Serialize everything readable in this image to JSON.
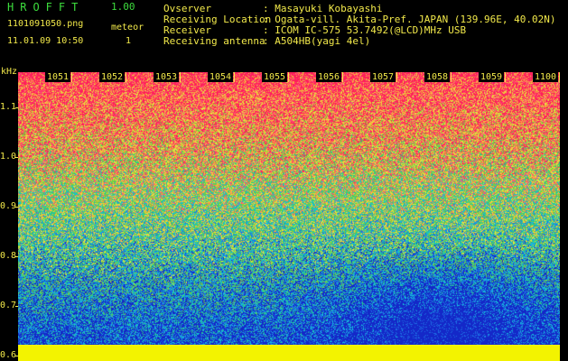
{
  "header": {
    "app_title": "HROFFT",
    "version": "1.00",
    "filename": "1101091050.png",
    "meteor_label": "meteor",
    "datetime": "11.01.09 10:50",
    "meteor_count": "1",
    "info": [
      {
        "label": "Ovserver",
        "value": ": Masayuki Kobayashi"
      },
      {
        "label": "Receiving Location",
        "value": ": Ogata-vill. Akita-Pref. JAPAN (139.96E, 40.02N)"
      },
      {
        "label": "Receiver",
        "value": ": ICOM IC-575 53.7492(@LCD)MHz USB"
      },
      {
        "label": "Receiving antenna",
        "value": ": A504HB(yagi 4el)"
      }
    ]
  },
  "chart_data": {
    "type": "heatmap",
    "title": "",
    "xlabel": "",
    "ylabel": "kHz",
    "x_ticks": [
      "1051",
      "1052",
      "1053",
      "1054",
      "1055",
      "1056",
      "1057",
      "1058",
      "1059",
      "1100"
    ],
    "y_ticks": [
      "1.1",
      "1.0",
      "0.9",
      "0.8",
      "0.7",
      "0.6"
    ],
    "ylim": [
      0.59,
      1.17
    ],
    "intensity_profile": "high (red/magenta) near top, decreasing through yellow/green to blue/cyan near bottom; solid yellow band at bottom edge",
    "colors": {
      "high": "#ff2d6a",
      "mid": "#e6e640",
      "low_green": "#40c080",
      "low_cyan": "#20c8d8",
      "lowest": "#2050e0",
      "band": "#f3f300"
    }
  }
}
